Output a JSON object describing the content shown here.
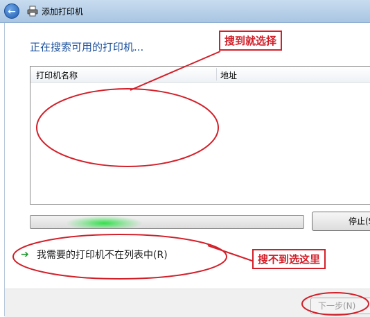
{
  "window": {
    "title": "添加打印机"
  },
  "main": {
    "heading": "正在搜索可用的打印机...",
    "list": {
      "columns": [
        "打印机名称",
        "地址"
      ]
    },
    "stop_label": "停止(S)",
    "not_listed_label": "我需要的打印机不在列表中(R)"
  },
  "footer": {
    "next_label": "下一步(N)"
  },
  "annotations": {
    "select_note": "搜到就选择",
    "not_found_note": "搜不到选这里"
  },
  "colors": {
    "annotation": "#d2202a",
    "heading": "#1a4f9c",
    "progress": "#32e04a"
  },
  "icons": {
    "back": "back-arrow-icon",
    "printer": "printer-icon",
    "link_arrow": "green-arrow-icon"
  }
}
